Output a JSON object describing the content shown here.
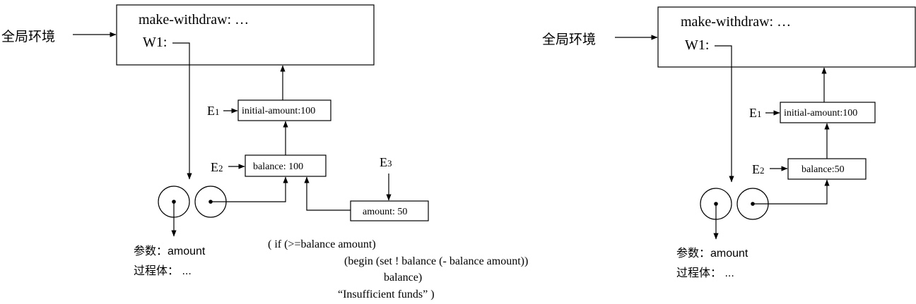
{
  "left": {
    "global_label": "全局环境",
    "global_frame": {
      "line1": "make-withdraw: …",
      "line2": "W1:"
    },
    "e1": {
      "label": "E",
      "sub": "1",
      "binding": "initial-amount:100"
    },
    "e2": {
      "label": "E",
      "sub": "2",
      "binding": "balance: 100"
    },
    "e3": {
      "label": "E",
      "sub": "3",
      "binding": "amount: 50"
    },
    "proc_params": "参数：amount",
    "proc_body": "过程体： ...",
    "code": [
      "( if (>=balance amount)",
      "(begin (set ! balance (- balance amount))",
      "balance)",
      "“Insufficient funds” )"
    ]
  },
  "right": {
    "global_label": "全局环境",
    "global_frame": {
      "line1": "make-withdraw: …",
      "line2": "W1:"
    },
    "e1": {
      "label": "E",
      "sub": "1",
      "binding": "initial-amount:100"
    },
    "e2": {
      "label": "E",
      "sub": "2",
      "binding": "balance:50"
    },
    "proc_params": "参数：amount",
    "proc_body": "过程体： ..."
  }
}
